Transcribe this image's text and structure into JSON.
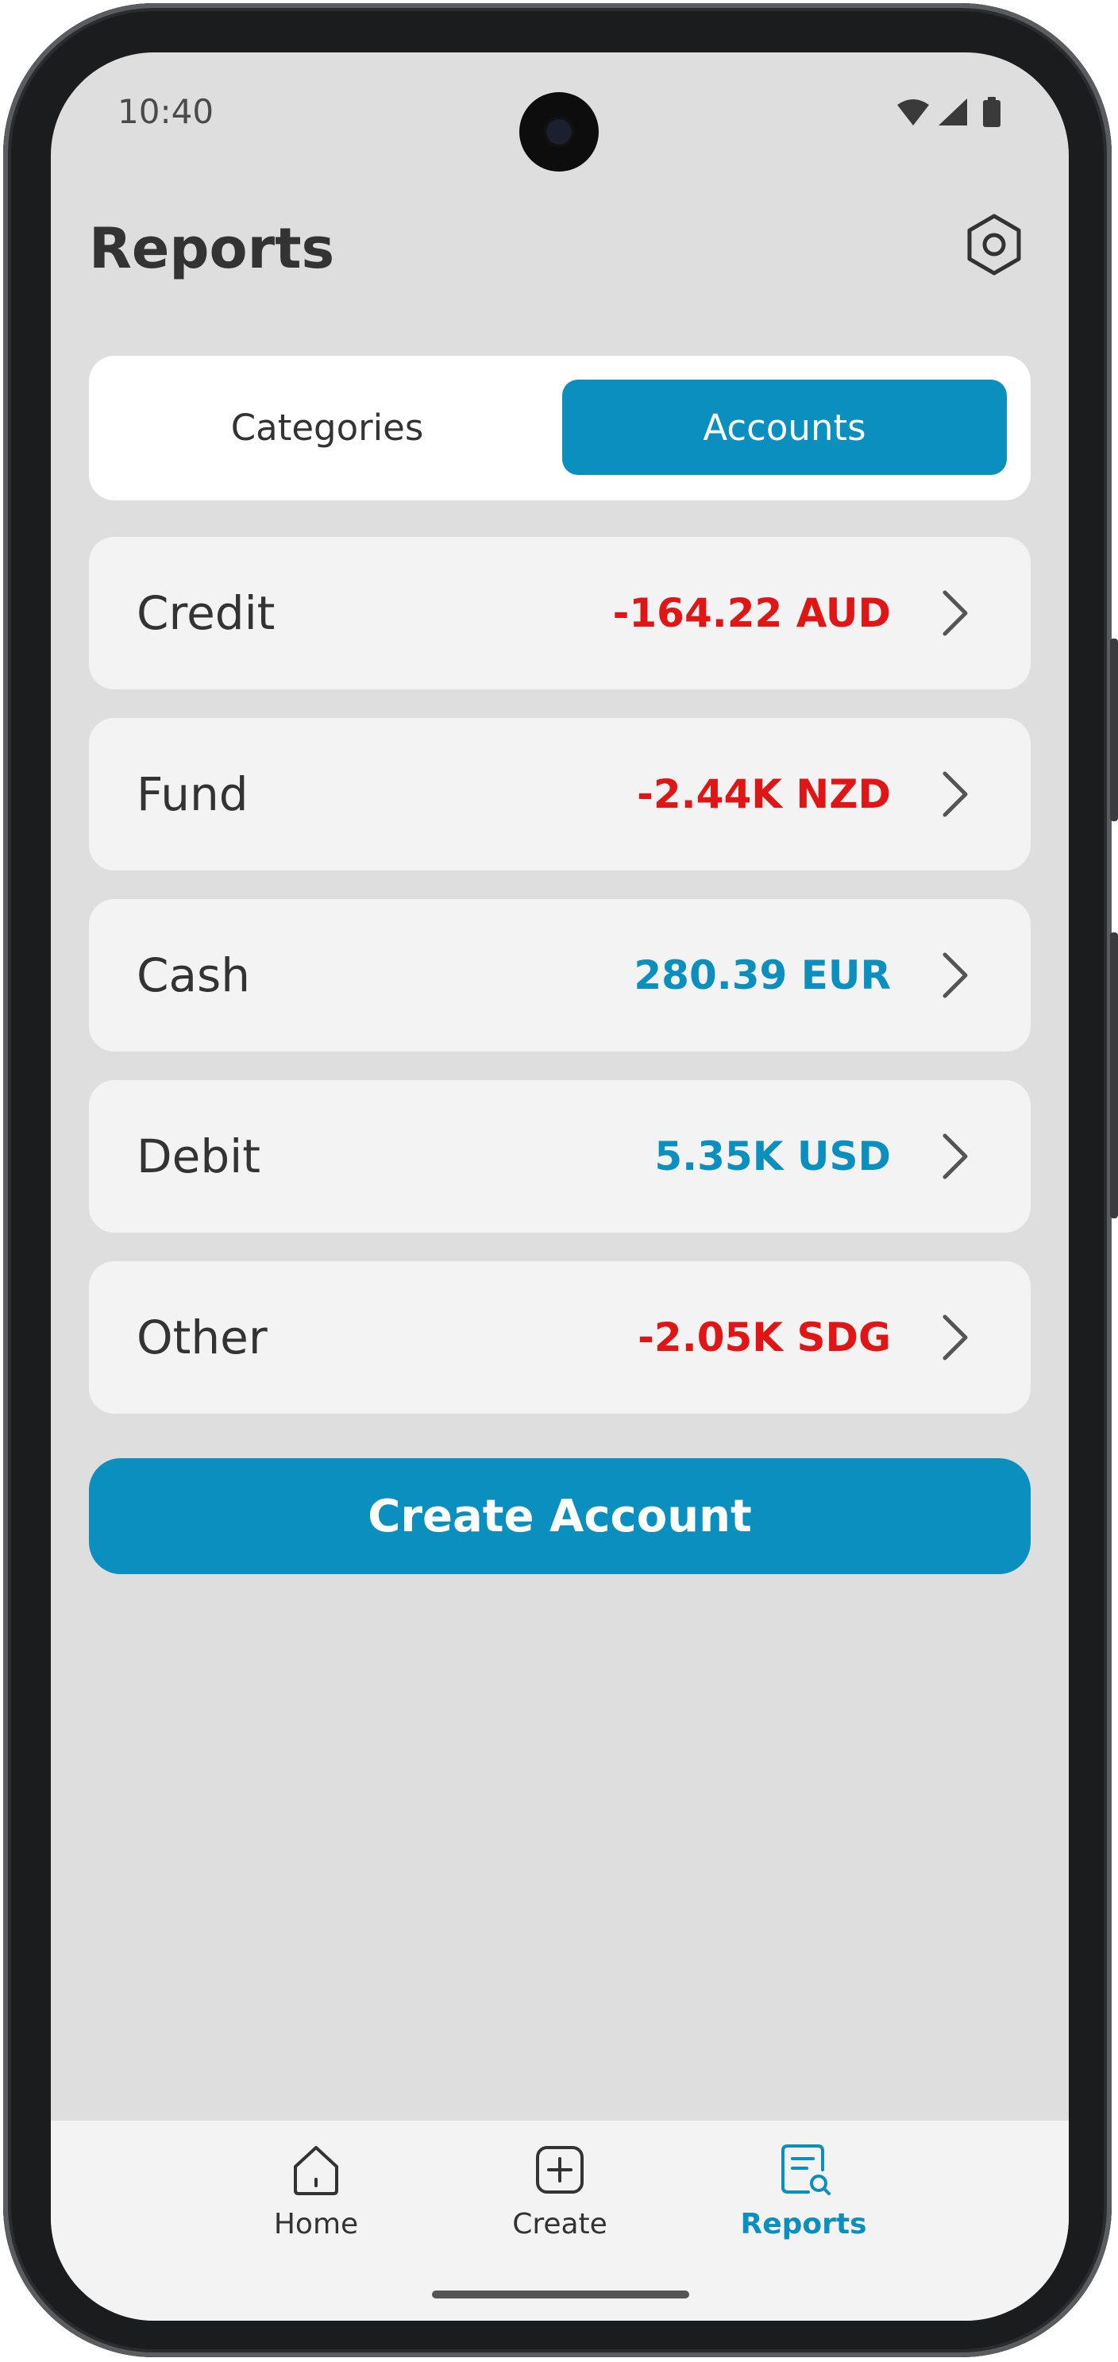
{
  "status_bar": {
    "time": "10:40",
    "icons": [
      "wifi-icon",
      "signal-icon",
      "battery-icon"
    ]
  },
  "header": {
    "title": "Reports",
    "settings_icon": "gear-icon"
  },
  "tabs": [
    {
      "label": "Categories",
      "selected": false
    },
    {
      "label": "Accounts",
      "selected": true
    }
  ],
  "accounts": [
    {
      "name": "Credit",
      "amount": "-164.22 AUD",
      "color": "#e01515"
    },
    {
      "name": "Fund",
      "amount": "-2.44K NZD",
      "color": "#e01515"
    },
    {
      "name": "Cash",
      "amount": "280.39 EUR",
      "color": "#0a8fbe"
    },
    {
      "name": "Debit",
      "amount": "5.35K USD",
      "color": "#0a8fbe"
    },
    {
      "name": "Other",
      "amount": "-2.05K SDG",
      "color": "#e01515"
    }
  ],
  "create_button": {
    "label": "Create Account"
  },
  "bottom_nav": [
    {
      "label": "Home",
      "icon": "home-icon",
      "active": false
    },
    {
      "label": "Create",
      "icon": "plus-square-icon",
      "active": false
    },
    {
      "label": "Reports",
      "icon": "report-search-icon",
      "active": true
    }
  ],
  "colors": {
    "accent": "#0a8fbe",
    "negative": "#e01515",
    "background": "#dedede",
    "card": "#f3f3f3"
  }
}
